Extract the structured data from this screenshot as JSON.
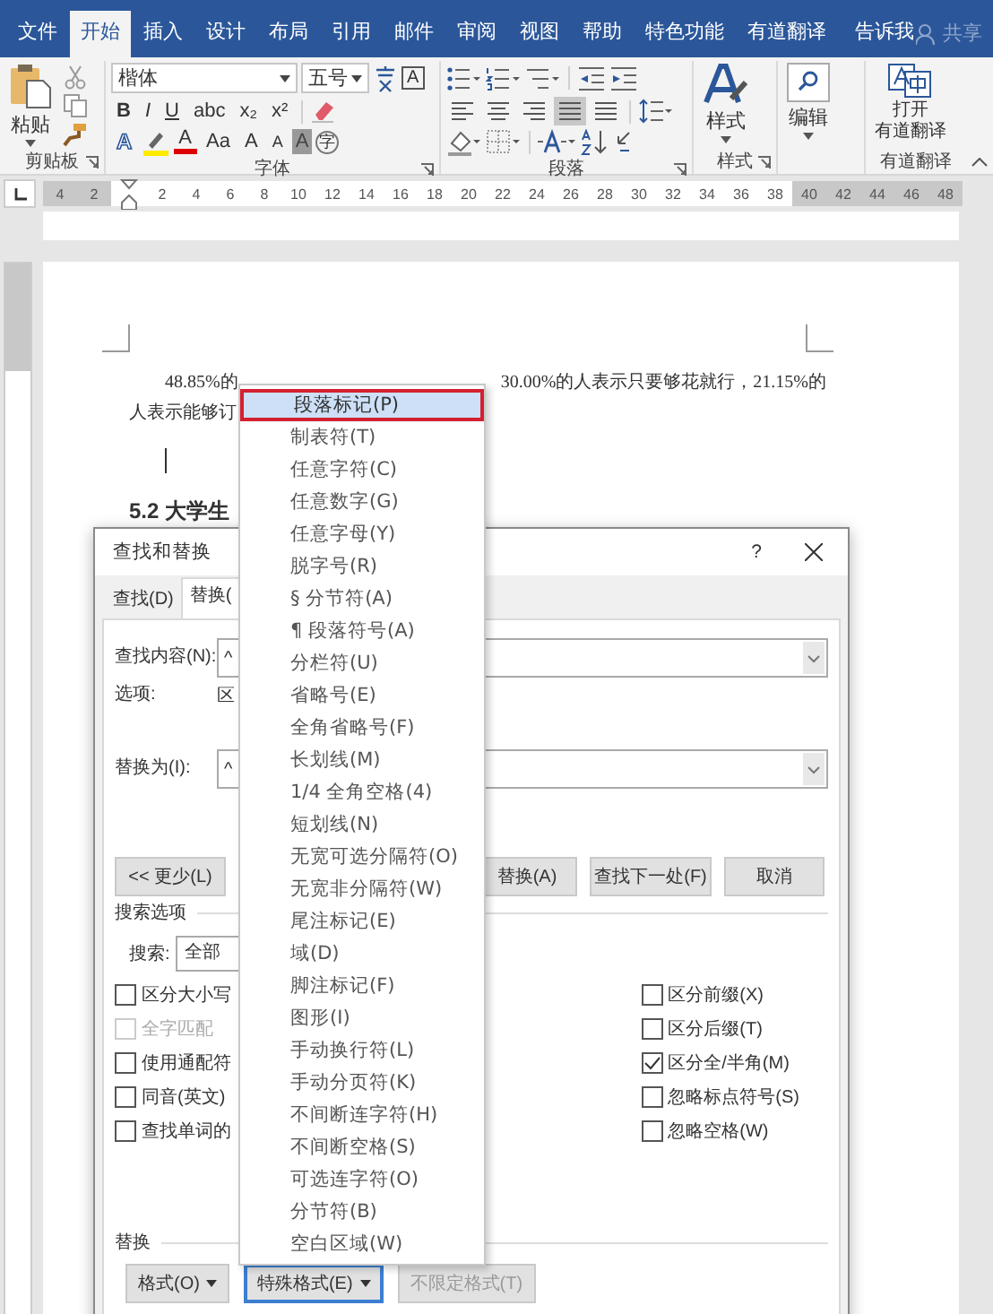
{
  "ribbon_tabs": [
    {
      "label": "文件",
      "selected": false
    },
    {
      "label": "开始",
      "selected": true
    },
    {
      "label": "插入",
      "selected": false
    },
    {
      "label": "设计",
      "selected": false
    },
    {
      "label": "布局",
      "selected": false
    },
    {
      "label": "引用",
      "selected": false
    },
    {
      "label": "邮件",
      "selected": false
    },
    {
      "label": "审阅",
      "selected": false
    },
    {
      "label": "视图",
      "selected": false
    },
    {
      "label": "帮助",
      "selected": false
    },
    {
      "label": "特色功能",
      "selected": false
    },
    {
      "label": "有道翻译",
      "selected": false
    }
  ],
  "tell_me": "告诉我",
  "share": "共享",
  "clipboard": {
    "paste": "粘贴",
    "label": "剪贴板"
  },
  "font": {
    "name": "楷体",
    "size": "五号",
    "boxed": "A",
    "row2": [
      {
        "text": "B",
        "kind": "bold"
      },
      {
        "text": "I",
        "kind": "italic"
      },
      {
        "text": "U",
        "kind": "underline"
      },
      {
        "text": "abc",
        "kind": "strike"
      },
      {
        "text": "x₂",
        "kind": "plain"
      },
      {
        "text": "x²",
        "kind": "plain"
      }
    ],
    "row3": [
      {
        "text": "A",
        "kind": "outline"
      },
      {
        "kind": "highlight"
      },
      {
        "text": "A",
        "kind": "color"
      },
      {
        "text": "Aa",
        "kind": "case"
      },
      {
        "text": "A",
        "kind": "grow"
      },
      {
        "text": "A",
        "kind": "shrink"
      },
      {
        "text": "A",
        "kind": "shade"
      },
      {
        "text": "字",
        "kind": "circle"
      }
    ],
    "label": "字体"
  },
  "paragraph": {
    "label": "段落",
    "alignments": [
      {
        "kind": "left",
        "selected": false
      },
      {
        "kind": "center",
        "selected": false
      },
      {
        "kind": "right",
        "selected": false
      },
      {
        "kind": "justify",
        "selected": true
      },
      {
        "kind": "distributed",
        "selected": false
      }
    ]
  },
  "styles": {
    "button": "样式",
    "label": "样式"
  },
  "editing": {
    "button": "编辑"
  },
  "translate": {
    "button": [
      "打开",
      "有道翻译"
    ],
    "label": "有道翻译"
  },
  "ruler": [
    {
      "label": "4",
      "margin": true
    },
    {
      "label": "2",
      "margin": true
    },
    {
      "label": "2",
      "margin": false
    },
    {
      "label": "4",
      "margin": false
    },
    {
      "label": "6",
      "margin": false
    },
    {
      "label": "8",
      "margin": false
    },
    {
      "label": "10",
      "margin": false
    },
    {
      "label": "12",
      "margin": false
    },
    {
      "label": "14",
      "margin": false
    },
    {
      "label": "16",
      "margin": false
    },
    {
      "label": "18",
      "margin": false
    },
    {
      "label": "20",
      "margin": false
    },
    {
      "label": "22",
      "margin": false
    },
    {
      "label": "24",
      "margin": false
    },
    {
      "label": "26",
      "margin": false
    },
    {
      "label": "28",
      "margin": false
    },
    {
      "label": "30",
      "margin": false
    },
    {
      "label": "32",
      "margin": false
    },
    {
      "label": "34",
      "margin": false
    },
    {
      "label": "36",
      "margin": false
    },
    {
      "label": "38",
      "margin": false
    },
    {
      "label": "40",
      "margin": true
    },
    {
      "label": "42",
      "margin": true
    },
    {
      "label": "44",
      "margin": true
    },
    {
      "label": "46",
      "margin": true
    },
    {
      "label": "48",
      "margin": true
    }
  ],
  "document": {
    "line1_start": "48.85%的",
    "line1_end": "30.00%的人表示只要够花就行，21.15%的",
    "line2": "人表示能够订",
    "heading": "5.2 大学生"
  },
  "dialog": {
    "title": "查找和替换",
    "help": "?",
    "tabs": [
      {
        "label": "查找(D)",
        "selected": false
      },
      {
        "label": "替换(",
        "selected": true
      }
    ],
    "find_label": "查找内容(N):",
    "find_value": "^",
    "options_label": "选项:",
    "options_value": "区",
    "replace_label": "替换为(I):",
    "replace_value": "^",
    "less_button": "<< 更少(L)",
    "buttons": [
      "替换(A)",
      "查找下一处(F)",
      "取消"
    ],
    "search_options": "搜索选项",
    "search_label": "搜索:",
    "search_value": "全部",
    "left_options": [
      {
        "label": "区分大小写",
        "checked": false,
        "disabled": false
      },
      {
        "label": "全字匹配",
        "checked": false,
        "disabled": true
      },
      {
        "label": "使用通配符",
        "checked": false,
        "disabled": false
      },
      {
        "label": "同音(英文)",
        "checked": false,
        "disabled": false
      },
      {
        "label": "查找单词的",
        "checked": false,
        "disabled": false
      }
    ],
    "right_options": [
      {
        "label": "区分前缀(X)",
        "checked": false
      },
      {
        "label": "区分后缀(T)",
        "checked": false
      },
      {
        "label": "区分全/半角(M)",
        "checked": true
      },
      {
        "label": "忽略标点符号(S)",
        "checked": false
      },
      {
        "label": "忽略空格(W)",
        "checked": false
      }
    ],
    "replace_section": "替换",
    "bottom_buttons": [
      {
        "label": "格式(O)",
        "dropdown": true,
        "focused": false,
        "disabled": false
      },
      {
        "label": "特殊格式(E)",
        "dropdown": true,
        "focused": true,
        "disabled": false
      },
      {
        "label": "不限定格式(T)",
        "dropdown": false,
        "focused": false,
        "disabled": true
      }
    ]
  },
  "menu": [
    {
      "label": "段落标记(P)",
      "selected": true
    },
    {
      "label": "制表符(T)",
      "selected": false
    },
    {
      "label": "任意字符(C)",
      "selected": false
    },
    {
      "label": "任意数字(G)",
      "selected": false
    },
    {
      "label": "任意字母(Y)",
      "selected": false
    },
    {
      "label": "脱字号(R)",
      "selected": false
    },
    {
      "label": "§ 分节符(A)",
      "selected": false
    },
    {
      "label": "¶ 段落符号(A)",
      "selected": false
    },
    {
      "label": "分栏符(U)",
      "selected": false
    },
    {
      "label": "省略号(E)",
      "selected": false
    },
    {
      "label": "全角省略号(F)",
      "selected": false
    },
    {
      "label": "长划线(M)",
      "selected": false
    },
    {
      "label": "1/4 全角空格(4)",
      "selected": false
    },
    {
      "label": "短划线(N)",
      "selected": false
    },
    {
      "label": "无宽可选分隔符(O)",
      "selected": false
    },
    {
      "label": "无宽非分隔符(W)",
      "selected": false
    },
    {
      "label": "尾注标记(E)",
      "selected": false
    },
    {
      "label": "域(D)",
      "selected": false
    },
    {
      "label": "脚注标记(F)",
      "selected": false
    },
    {
      "label": "图形(I)",
      "selected": false
    },
    {
      "label": "手动换行符(L)",
      "selected": false
    },
    {
      "label": "手动分页符(K)",
      "selected": false
    },
    {
      "label": "不间断连字符(H)",
      "selected": false
    },
    {
      "label": "不间断空格(S)",
      "selected": false
    },
    {
      "label": "可选连字符(O)",
      "selected": false
    },
    {
      "label": "分节符(B)",
      "selected": false
    },
    {
      "label": "空白区域(W)",
      "selected": false
    }
  ]
}
